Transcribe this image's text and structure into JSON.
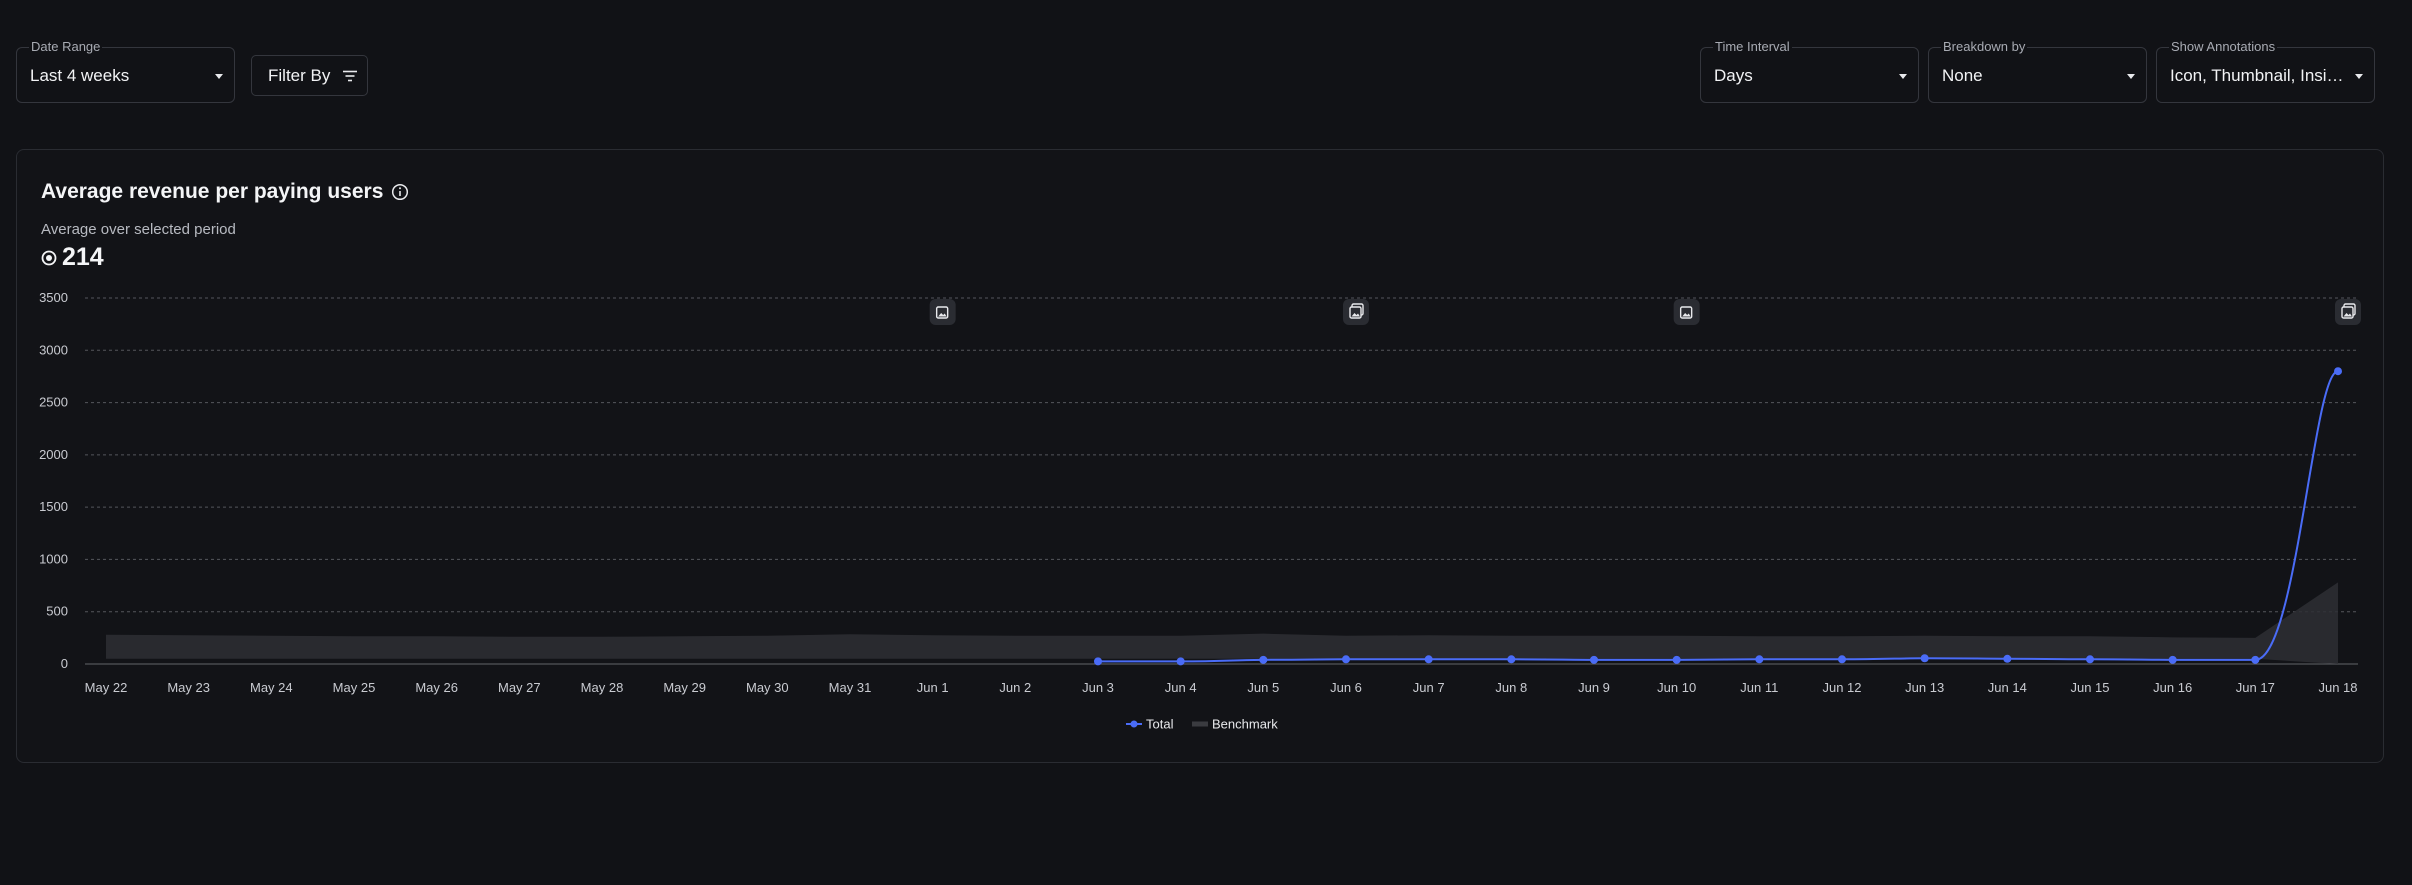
{
  "controls": {
    "date_range": {
      "label": "Date Range",
      "value": "Last 4 weeks"
    },
    "filter": {
      "label": "Filter By"
    },
    "time_interval": {
      "label": "Time Interval",
      "value": "Days"
    },
    "breakdown": {
      "label": "Breakdown by",
      "value": "None"
    },
    "annotations": {
      "label": "Show Annotations",
      "value": "Icon, Thumbnail, Insigh..."
    }
  },
  "card": {
    "title": "Average revenue per paying users",
    "subtitle": "Average over selected period",
    "metric_value": "214"
  },
  "colors": {
    "total": "#4a6cf7",
    "benchmark": "#2e2f34",
    "grid": "#6b6d73"
  },
  "chart_data": {
    "type": "line",
    "x": [
      "May 22",
      "May 23",
      "May 24",
      "May 25",
      "May 26",
      "May 27",
      "May 28",
      "May 29",
      "May 30",
      "May 31",
      "Jun 1",
      "Jun 2",
      "Jun 3",
      "Jun 4",
      "Jun 5",
      "Jun 6",
      "Jun 7",
      "Jun 8",
      "Jun 9",
      "Jun 10",
      "Jun 11",
      "Jun 12",
      "Jun 13",
      "Jun 14",
      "Jun 15",
      "Jun 16",
      "Jun 17",
      "Jun 18"
    ],
    "ylim": [
      0,
      3500
    ],
    "yticks": [
      0,
      500,
      1000,
      1500,
      2000,
      2500,
      3000,
      3500
    ],
    "grid": true,
    "legend_position": "bottom-center",
    "series": [
      {
        "name": "Total",
        "type": "line",
        "values": [
          null,
          null,
          null,
          null,
          null,
          null,
          null,
          null,
          null,
          null,
          null,
          null,
          25,
          25,
          40,
          45,
          45,
          45,
          40,
          40,
          45,
          45,
          55,
          50,
          45,
          40,
          40,
          2800
        ]
      },
      {
        "name": "Benchmark",
        "type": "area_band",
        "lower": [
          50,
          50,
          50,
          50,
          50,
          50,
          50,
          50,
          50,
          50,
          50,
          50,
          50,
          50,
          50,
          50,
          50,
          50,
          50,
          50,
          50,
          50,
          50,
          50,
          50,
          50,
          50,
          0
        ],
        "upper": [
          280,
          275,
          270,
          265,
          265,
          260,
          260,
          265,
          270,
          285,
          275,
          270,
          270,
          270,
          290,
          270,
          275,
          270,
          270,
          270,
          265,
          265,
          270,
          265,
          265,
          255,
          250,
          780
        ]
      }
    ],
    "annotation_markers": [
      {
        "x": "Jun 1",
        "icon": "image-icon"
      },
      {
        "x": "Jun 6",
        "icon": "image-stack-icon"
      },
      {
        "x": "Jun 10",
        "icon": "image-icon"
      },
      {
        "x": "Jun 18",
        "icon": "image-stack-icon"
      }
    ]
  }
}
